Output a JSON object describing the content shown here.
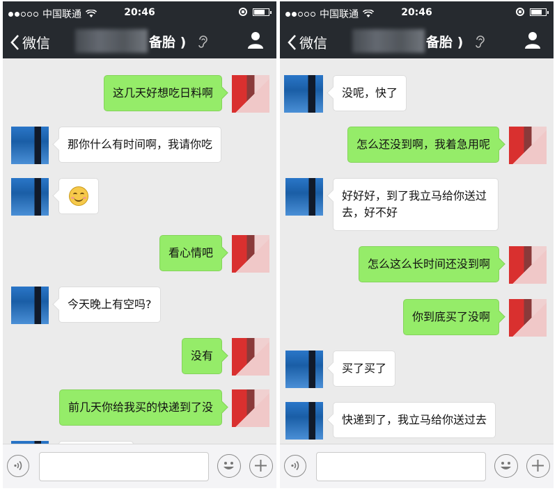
{
  "status_bar": {
    "carrier": "中国联通",
    "time": "20:46"
  },
  "nav": {
    "back_label": "微信",
    "title": "备胎 )"
  },
  "left_screen": {
    "messages": [
      {
        "side": "right",
        "text": "这几天好想吃日料啊"
      },
      {
        "side": "left",
        "text": "那你什么有时间啊，我请你吃"
      },
      {
        "side": "left",
        "text": "",
        "emoji": "smile-emoji"
      },
      {
        "side": "right",
        "text": "看心情吧"
      },
      {
        "side": "left",
        "text": "今天晚上有空吗?"
      },
      {
        "side": "right",
        "text": "没有"
      },
      {
        "side": "right",
        "text": "前几天你给我买的快递到了没"
      }
    ]
  },
  "right_screen": {
    "messages": [
      {
        "side": "left",
        "text": "没呢，快了"
      },
      {
        "side": "right",
        "text": "怎么还没到啊，我着急用呢"
      },
      {
        "side": "left",
        "text": "好好好，到了我立马给你送过去，好不好"
      },
      {
        "side": "right",
        "text": "怎么这么长时间还没到啊"
      },
      {
        "side": "right",
        "text": "你到底买了没啊"
      },
      {
        "side": "left",
        "text": "买了买了"
      },
      {
        "side": "left",
        "text": "快递到了，我立马给你送过去"
      }
    ]
  },
  "colors": {
    "nav_bg": "#262a2f",
    "bubble_sent": "#95ec69",
    "bubble_received": "#ffffff",
    "chat_bg": "#ebebeb"
  },
  "icons": [
    "back-chevron-icon",
    "ear-icon",
    "person-icon",
    "voice-icon",
    "emoji-icon",
    "plus-icon",
    "wifi-icon",
    "battery-icon",
    "lock-rotation-icon"
  ]
}
